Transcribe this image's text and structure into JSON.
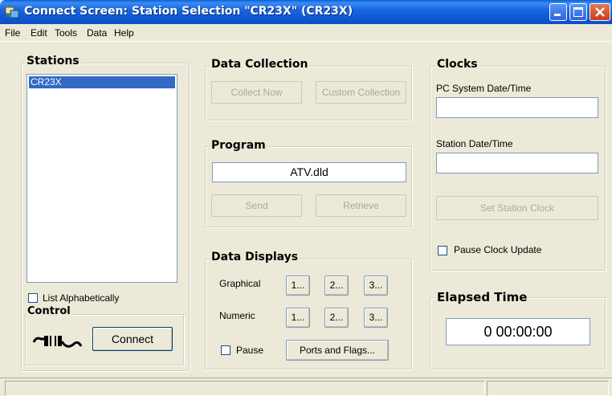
{
  "window": {
    "title": "Connect Screen: Station Selection \"CR23X\" (CR23X)",
    "app_icon": "connect-screen-app-icon",
    "controls": [
      "minimize-icon",
      "maximize-icon",
      "close-icon"
    ]
  },
  "menu": [
    "File",
    "Edit",
    "Tools",
    "Data",
    "Help"
  ],
  "stations": {
    "label": "Stations",
    "items": [
      "CR23X"
    ],
    "list_alphabetically": "List Alphabetically"
  },
  "control": {
    "label": "Control",
    "connect": "Connect",
    "icon": "disconnected-cable-icon"
  },
  "data_collection": {
    "label": "Data Collection",
    "collect_now": "Collect Now",
    "custom_collection": "Custom Collection"
  },
  "program": {
    "label": "Program",
    "file": "ATV.dld",
    "send": "Send",
    "retrieve": "Retrieve"
  },
  "data_displays": {
    "label": "Data Displays",
    "graphical": "Graphical",
    "numeric": "Numeric",
    "buttons": [
      "1...",
      "2...",
      "3..."
    ],
    "pause": "Pause",
    "ports_and_flags": "Ports and Flags..."
  },
  "clocks": {
    "label": "Clocks",
    "pc_system_label": "PC System Date/Time",
    "pc_system_value": "",
    "station_label": "Station Date/Time",
    "station_value": "",
    "set_station_clock": "Set Station Clock",
    "pause_clock_update": "Pause Clock Update"
  },
  "elapsed": {
    "label": "Elapsed Time",
    "value": "0 00:00:00"
  },
  "status": {
    "pane1": "",
    "pane2": ""
  }
}
